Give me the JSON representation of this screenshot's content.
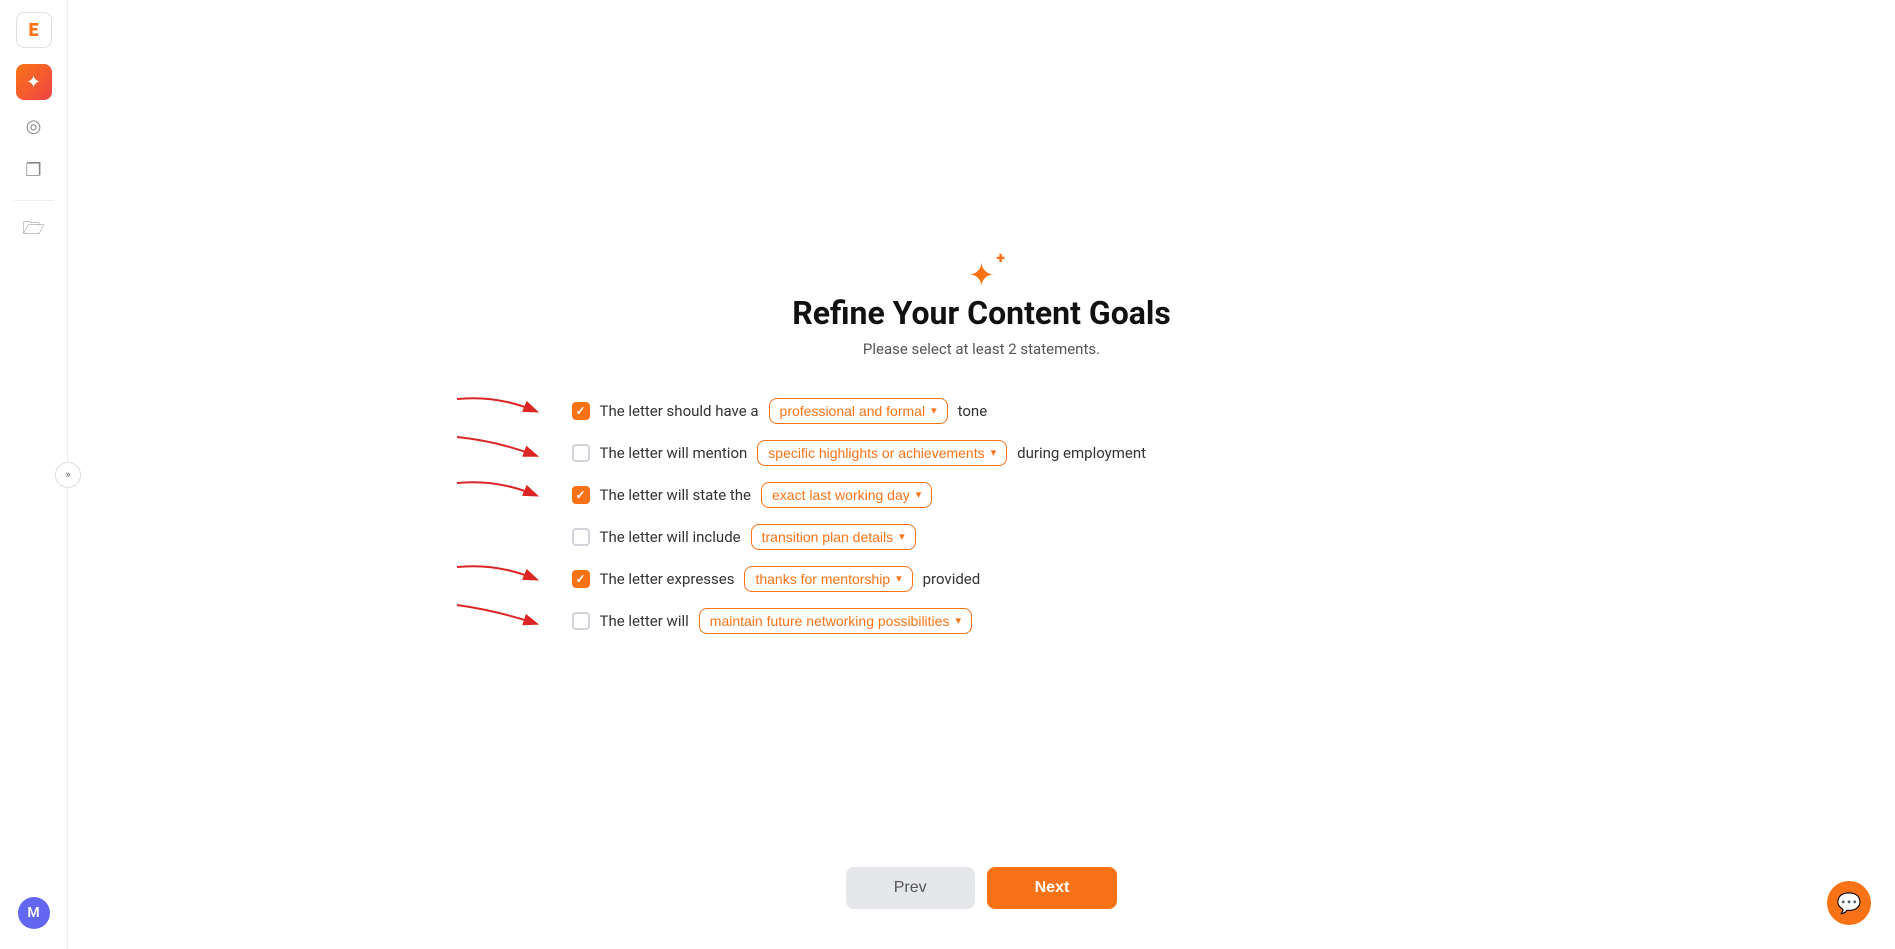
{
  "sidebar": {
    "logo_text": "E",
    "collapse_label": "»",
    "avatar_label": "M",
    "items": [
      {
        "name": "sparkle",
        "icon": "✦",
        "active": true
      },
      {
        "name": "headphones",
        "icon": "🎧",
        "active": false
      },
      {
        "name": "copy",
        "icon": "⧉",
        "active": false
      },
      {
        "name": "folder",
        "icon": "🗂",
        "active": false
      }
    ]
  },
  "page": {
    "title": "Refine Your Content Goals",
    "subtitle": "Please select at least 2 statements.",
    "options": [
      {
        "id": "tone",
        "checked": true,
        "prefix": "The letter should have a",
        "dropdown_value": "professional and formal",
        "suffix": "tone",
        "has_arrow": true
      },
      {
        "id": "highlights",
        "checked": false,
        "prefix": "The letter will mention",
        "dropdown_value": "specific highlights or achievements",
        "suffix": "during employment",
        "has_arrow": true
      },
      {
        "id": "lastday",
        "checked": true,
        "prefix": "The letter will state the",
        "dropdown_value": "exact last working day",
        "suffix": "",
        "has_arrow": true
      },
      {
        "id": "transition",
        "checked": false,
        "prefix": "The letter will include",
        "dropdown_value": "transition plan details",
        "suffix": "",
        "has_arrow": false
      },
      {
        "id": "mentorship",
        "checked": true,
        "prefix": "The letter expresses",
        "dropdown_value": "thanks for mentorship",
        "suffix": "provided",
        "has_arrow": true
      },
      {
        "id": "networking",
        "checked": false,
        "prefix": "The letter will",
        "dropdown_value": "maintain future networking possibilities",
        "suffix": "",
        "has_arrow": false
      }
    ],
    "buttons": {
      "prev": "Prev",
      "next": "Next"
    }
  }
}
